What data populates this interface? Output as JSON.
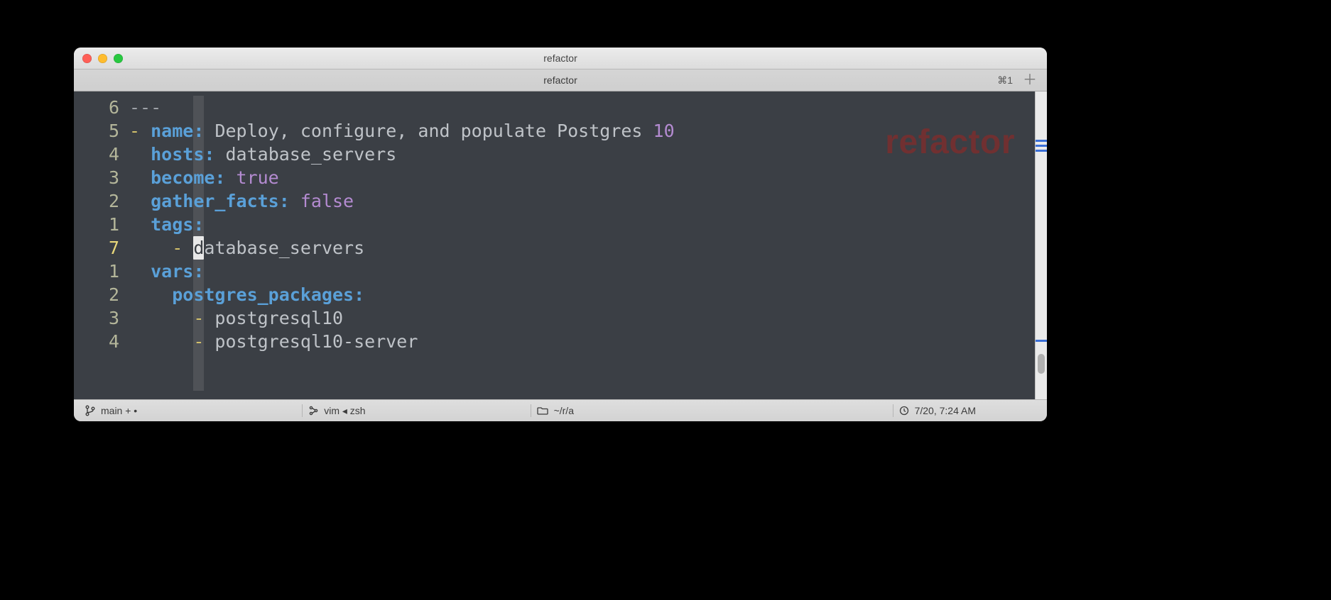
{
  "window": {
    "title": "refactor",
    "tab_title": "refactor",
    "tab_shortcut": "⌘1",
    "watermark": "refactor"
  },
  "gutter": [
    "6",
    "5",
    "4",
    "3",
    "2",
    "1",
    "7",
    "1",
    "2",
    "3",
    "4"
  ],
  "code": {
    "l0": "---",
    "l1": {
      "dash": "- ",
      "key": "name",
      "sep": ": ",
      "val": "Deploy, configure, and populate Postgres ",
      "num": "10"
    },
    "l2": {
      "pad": "  ",
      "key": "hosts",
      "sep": ": ",
      "val": "database_servers"
    },
    "l3": {
      "pad": "  ",
      "key": "become",
      "sep": ": ",
      "val": "true"
    },
    "l4": {
      "pad": "  ",
      "key": "gather_facts",
      "sep": ": ",
      "val": "false"
    },
    "l5": {
      "pad": "  ",
      "key": "tags",
      "sep": ":"
    },
    "l6": {
      "pad": "    ",
      "dash": "- ",
      "cursor": "d",
      "rest": "atabase_servers"
    },
    "l7": {
      "pad": "  ",
      "key": "vars",
      "sep": ":"
    },
    "l8": {
      "pad": "    ",
      "key": "postgres_packages",
      "sep": ":"
    },
    "l9": {
      "pad": "      ",
      "dash": "- ",
      "val": "postgresql10"
    },
    "l10": {
      "pad": "      ",
      "dash": "- ",
      "val": "postgresql10-server"
    }
  },
  "status": {
    "branch": "main + •",
    "process": "vim ◂ zsh",
    "path": "~/r/a",
    "time": "7/20, 7:24 AM"
  }
}
